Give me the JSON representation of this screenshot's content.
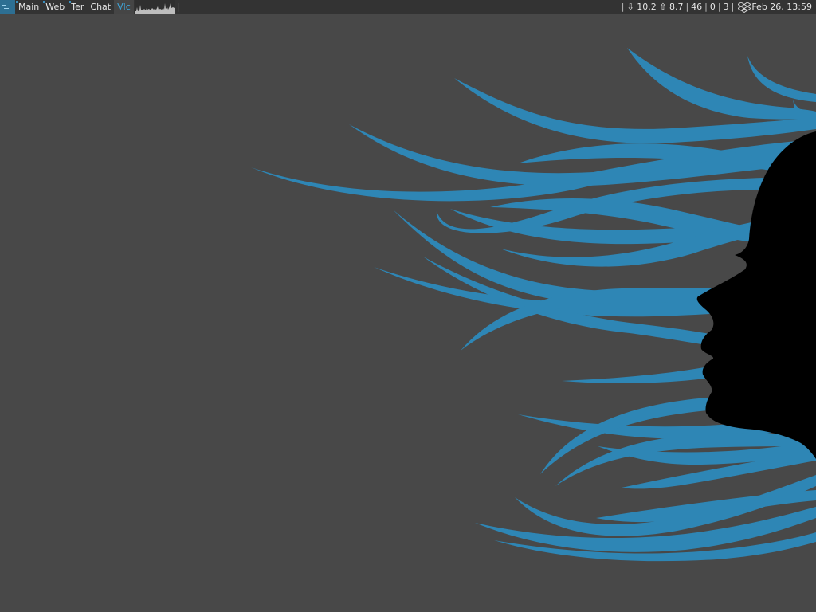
{
  "topbar": {
    "tags": [
      {
        "label": "Main",
        "has_clients": true
      },
      {
        "label": "Web",
        "has_clients": true
      },
      {
        "label": "Ter",
        "has_clients": true
      },
      {
        "label": "Chat",
        "has_clients": false
      },
      {
        "label": "Vlc",
        "active": true
      }
    ],
    "separator": "|",
    "down_arrow": "⇩",
    "net_down": "10.2",
    "up_arrow": "⇧",
    "net_up": "8.7",
    "widget_a": "46",
    "widget_b": "0",
    "widget_c": "3",
    "datetime": "Feb 26, 13:59"
  },
  "colors": {
    "bar_bg": "#333333",
    "accent": "#3fa4d8",
    "hair": "#2e86b5",
    "desktop": "#484848",
    "silhouette": "#000000"
  },
  "icons": [
    "layout-tile-icon",
    "cpu-graph",
    "dropbox-icon"
  ]
}
